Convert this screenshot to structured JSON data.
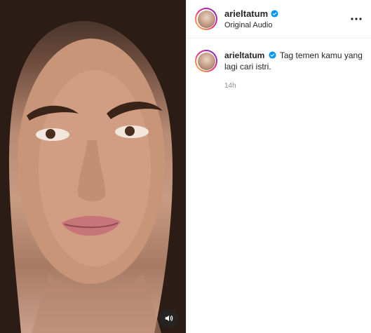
{
  "post": {
    "username": "arieltatum",
    "audio_label": "Original Audio",
    "caption": "Tag temen kamu yang lagi cari istri.",
    "time_ago": "14h"
  },
  "icons": {
    "verified": "verified-badge-icon",
    "more": "more-options-icon",
    "sound": "sound-on-icon"
  },
  "colors": {
    "verified_blue": "#0095f6",
    "muted_text": "#8e8e8e",
    "divider": "#efefef"
  }
}
